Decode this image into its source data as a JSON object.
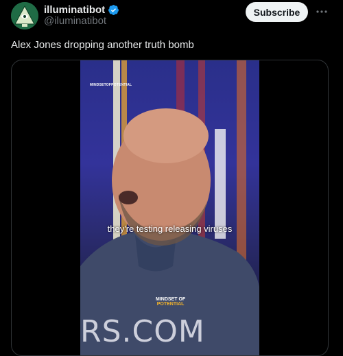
{
  "author": {
    "display_name": "illuminatibot",
    "handle": "@iluminatibot",
    "verified": true,
    "avatar_icon": "illuminati-eye-pyramid-icon",
    "avatar_color": "#1f6b45"
  },
  "header": {
    "subscribe_label": "Subscribe",
    "more_icon": "more-dots-icon"
  },
  "tweet": {
    "text": "Alex Jones dropping another truth bomb"
  },
  "video": {
    "watermark_top": "MINDSETOFPOTENTIAL",
    "caption": "they're testing releasing viruses",
    "watermark_bottom_line1": "MINDSET OF",
    "watermark_bottom_line2": "POTENTIAL",
    "background_text": "RS.COM"
  },
  "colors": {
    "background": "#000000",
    "text_primary": "#e7e9ea",
    "text_secondary": "#71767b",
    "verified_blue": "#1d9bf0",
    "button_bg": "#eff3f4",
    "border": "#2f3336"
  }
}
